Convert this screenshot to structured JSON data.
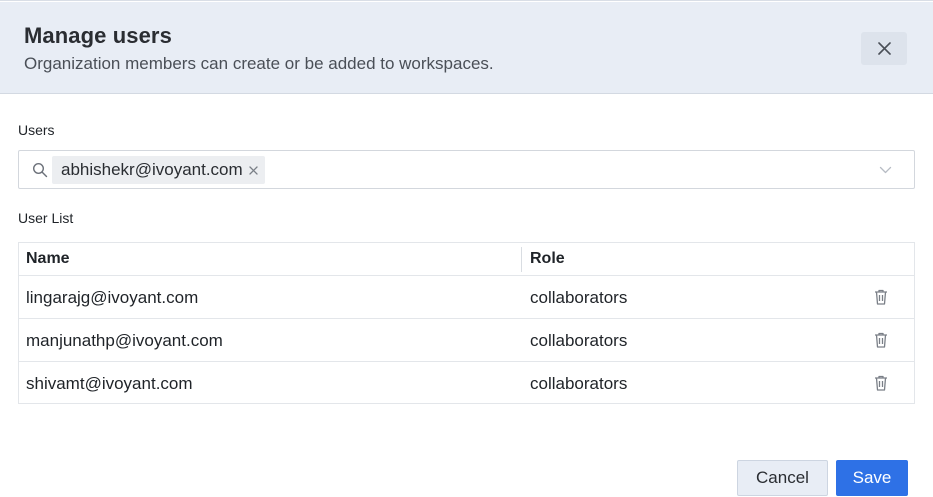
{
  "header": {
    "title": "Manage users",
    "subtitle": "Organization members can create or be added to workspaces."
  },
  "users_field": {
    "label": "Users",
    "selected_tags": [
      "abhishekr@ivoyant.com"
    ]
  },
  "user_list": {
    "label": "User List",
    "columns": [
      "Name",
      "Role"
    ],
    "rows": [
      {
        "name": "lingarajg@ivoyant.com",
        "role": "collaborators"
      },
      {
        "name": "manjunathp@ivoyant.com",
        "role": "collaborators"
      },
      {
        "name": "shivamt@ivoyant.com",
        "role": "collaborators"
      }
    ]
  },
  "footer": {
    "cancel_label": "Cancel",
    "save_label": "Save"
  },
  "colors": {
    "header_bg": "#e8edf5",
    "primary": "#2e71e6",
    "tag_bg": "#eceef1"
  },
  "icons": [
    "close-icon",
    "search-icon",
    "tag-remove-icon",
    "chevron-down-icon",
    "trash-icon"
  ]
}
